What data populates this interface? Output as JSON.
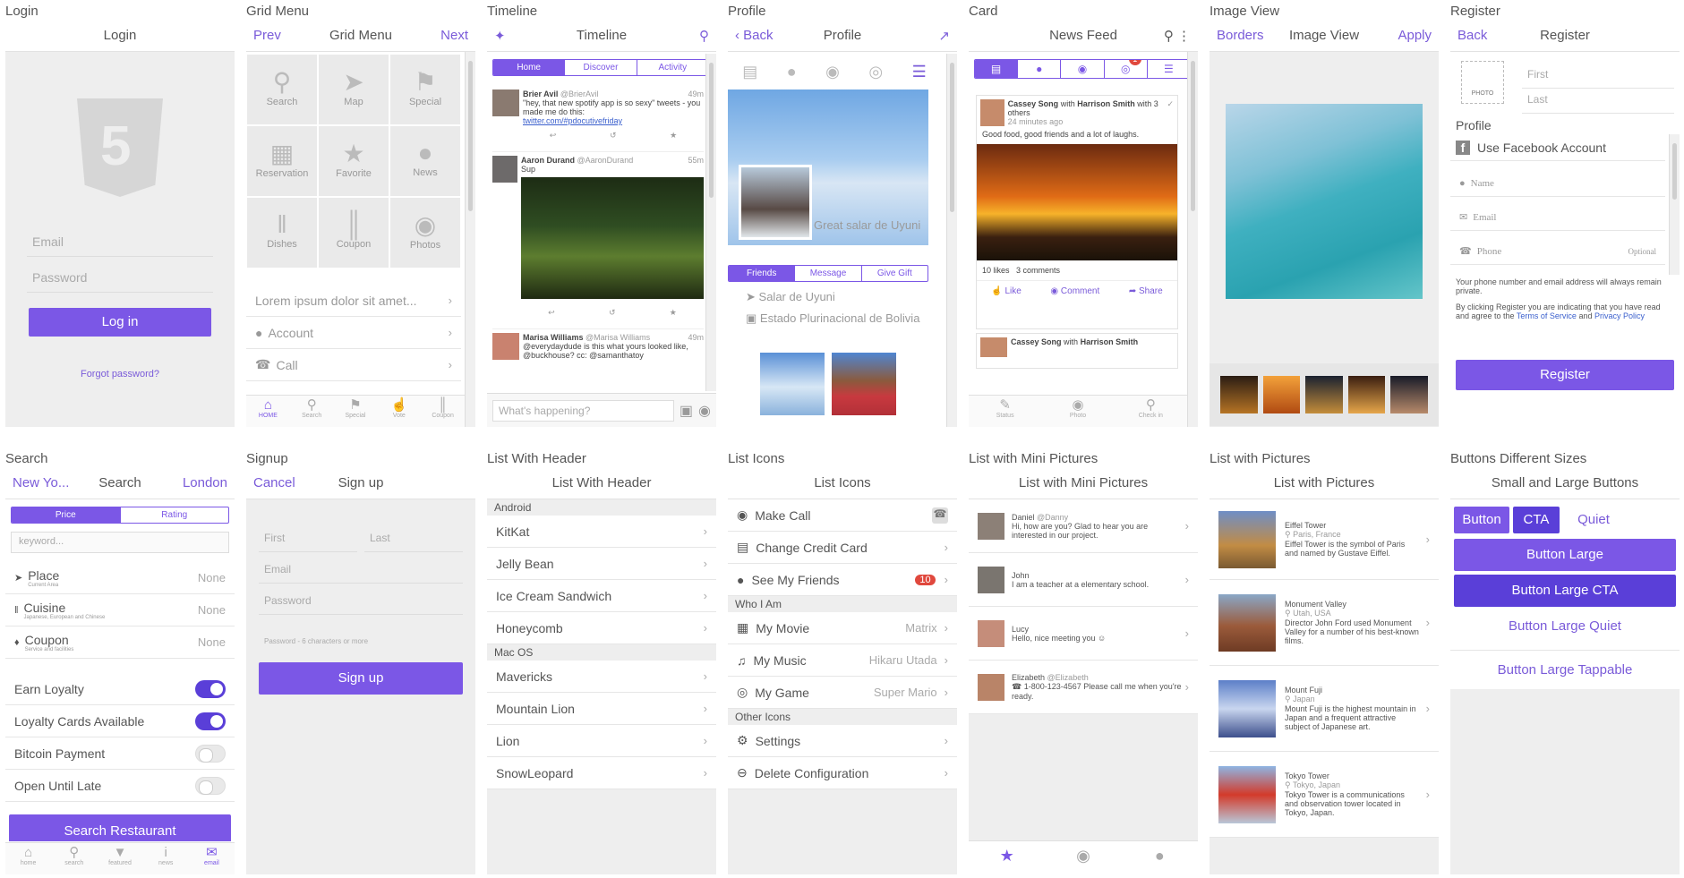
{
  "colors": {
    "accent": "#7b57e6",
    "accent_dark": "#5a3fd8",
    "badge": "#e0483d"
  },
  "login": {
    "caption": "Login",
    "title": "Login",
    "email": "Email",
    "password": "Password",
    "button": "Log in",
    "forgot": "Forgot password?"
  },
  "grid": {
    "caption": "Grid Menu",
    "title": "Grid Menu",
    "prev": "Prev",
    "next": "Next",
    "cells": [
      "Search",
      "Map",
      "Special",
      "Reservation",
      "Favorite",
      "News",
      "Dishes",
      "Coupon",
      "Photos"
    ],
    "rows": [
      "Lorem ipsum dolor sit amet...",
      "Account",
      "Call"
    ],
    "tabs": [
      "HOME",
      "Search",
      "Special",
      "Vote",
      "Coupon"
    ]
  },
  "timeline": {
    "caption": "Timeline",
    "title": "Timeline",
    "tabs": [
      "Home",
      "Discover",
      "Activity"
    ],
    "t1_name": "Brier Avil",
    "t1_handle": "@BrierAvil",
    "t1_time": "49m",
    "t1_text": "\"hey, that new spotify app is so sexy\" tweets - you made me do this:",
    "t1_link": "twitter.com/#pdocutivefriday",
    "t2_name": "Aaron Durand",
    "t2_handle": "@AaronDurand",
    "t2_time": "55m",
    "t2_text": "Sup",
    "t3_name": "Marisa Williams",
    "t3_handle": "@Marisa Williams",
    "t3_time": "49m",
    "t3_text": "@everydaydude is this what yours looked like, @buckhouse? cc: @samanthatoy",
    "compose": "What's happening?"
  },
  "profile": {
    "caption": "Profile",
    "title": "Profile",
    "back": "Back",
    "photo_caption": "Great salar de Uyuni",
    "tabs": [
      "Friends",
      "Message",
      "Give Gift"
    ],
    "loc1": "Salar de Uyuni",
    "loc2": "Estado Plurinacional de Bolivia"
  },
  "card": {
    "caption": "Card",
    "title": "News Feed",
    "badge": "1",
    "name": "Cassey Song",
    "with": "with",
    "other": "Harrison Smith",
    "others": "with 3 others",
    "time": "24 minutes ago",
    "text": "Good food, good friends and a lot of laughs.",
    "likes": "10 likes",
    "comments": "3 comments",
    "like": "Like",
    "comment": "Comment",
    "share": "Share",
    "tabs": [
      "Status",
      "Photo",
      "Check in"
    ]
  },
  "imageview": {
    "caption": "Image View",
    "title": "Image View",
    "left": "Borders",
    "right": "Apply"
  },
  "register": {
    "caption": "Register",
    "title": "Register",
    "back": "Back",
    "photo": "PHOTO",
    "first": "First",
    "last": "Last",
    "profile": "Profile",
    "facebook": "Use Facebook Account",
    "name": "Name",
    "email": "Email",
    "phone": "Phone",
    "optional": "Optional",
    "note1": "Your phone number and email address will always remain private.",
    "note2": "By clicking Register you are indicating that you have read and agree to the",
    "terms": "Terms of Service",
    "and": "and",
    "privacy": "Privacy Policy",
    "button": "Register"
  },
  "search": {
    "caption": "Search",
    "title": "Search",
    "left": "New Yo...",
    "right": "London",
    "seg": [
      "Price",
      "Rating"
    ],
    "placeholder": "keyword...",
    "items": [
      {
        "label": "Place",
        "sub": "Current Area",
        "val": "None"
      },
      {
        "label": "Cuisine",
        "sub": "Japanese, European and Chinese",
        "val": "None"
      },
      {
        "label": "Coupon",
        "sub": "Service and facilities",
        "val": "None"
      }
    ],
    "toggles": [
      {
        "label": "Earn Loyalty",
        "on": true
      },
      {
        "label": "Loyalty Cards Available",
        "on": true
      },
      {
        "label": "Bitcoin Payment",
        "on": false
      },
      {
        "label": "Open Until Late",
        "on": false
      }
    ],
    "button": "Search Restaurant",
    "tabs": [
      "home",
      "search",
      "featured",
      "news",
      "email"
    ]
  },
  "signup": {
    "caption": "Signup",
    "title": "Sign up",
    "cancel": "Cancel",
    "first": "First",
    "last": "Last",
    "email": "Email",
    "password": "Password",
    "hint": "Password - 6 characters or more",
    "button": "Sign up"
  },
  "listheader": {
    "caption": "List With Header",
    "title": "List With Header",
    "sec1": "Android",
    "android": [
      "KitKat",
      "Jelly Bean",
      "Ice Cream Sandwich",
      "Honeycomb"
    ],
    "sec2": "Mac OS",
    "mac": [
      "Mavericks",
      "Mountain Lion",
      "Lion",
      "SnowLeopard"
    ]
  },
  "listicons": {
    "caption": "List Icons",
    "title": "List Icons",
    "make_call": "Make Call",
    "credit": "Change Credit Card",
    "friends": "See My Friends",
    "friends_count": "10",
    "sec1": "Who I Am",
    "movie": "My Movie",
    "movie_val": "Matrix",
    "music": "My Music",
    "music_val": "Hikaru Utada",
    "game": "My Game",
    "game_val": "Super Mario",
    "sec2": "Other Icons",
    "settings": "Settings",
    "delete": "Delete Configuration"
  },
  "minipics": {
    "caption": "List with Mini Pictures",
    "title": "List with Mini Pictures",
    "items": [
      {
        "name": "Daniel",
        "handle": "@Danny",
        "text": "Hi, how are you? Glad to hear you are interested in our project."
      },
      {
        "name": "John",
        "handle": "",
        "text": "I am a teacher at a elementary school."
      },
      {
        "name": "Lucy",
        "handle": "",
        "text": "Hello, nice meeting you ☺"
      },
      {
        "name": "Elizabeth",
        "handle": "@Elizabeth",
        "text": "☎ 1-800-123-4567 Please call me when you're ready."
      }
    ]
  },
  "pics": {
    "caption": "List with Pictures",
    "title": "List with Pictures",
    "items": [
      {
        "name": "Eiffel Tower",
        "loc": "Paris, France",
        "text": "Eiffel Tower is the symbol of Paris and named by Gustave Eiffel."
      },
      {
        "name": "Monument Valley",
        "loc": "Utah, USA",
        "text": "Director John Ford used Monument Valley for a number of his best-known films."
      },
      {
        "name": "Mount Fuji",
        "loc": "Japan",
        "text": "Mount Fuji is the highest mountain in Japan and a frequent attractive subject of Japanese art."
      },
      {
        "name": "Tokyo Tower",
        "loc": "Tokyo, Japan",
        "text": "Tokyo Tower is a communications and observation tower located in Tokyo, Japan."
      }
    ]
  },
  "buttons": {
    "caption": "Buttons Different Sizes",
    "title": "Small and Large Buttons",
    "small": [
      "Button",
      "CTA",
      "Quiet"
    ],
    "large": "Button Large",
    "large_cta": "Button Large CTA",
    "large_quiet": "Button Large Quiet",
    "tappable": "Button Large Tappable"
  }
}
